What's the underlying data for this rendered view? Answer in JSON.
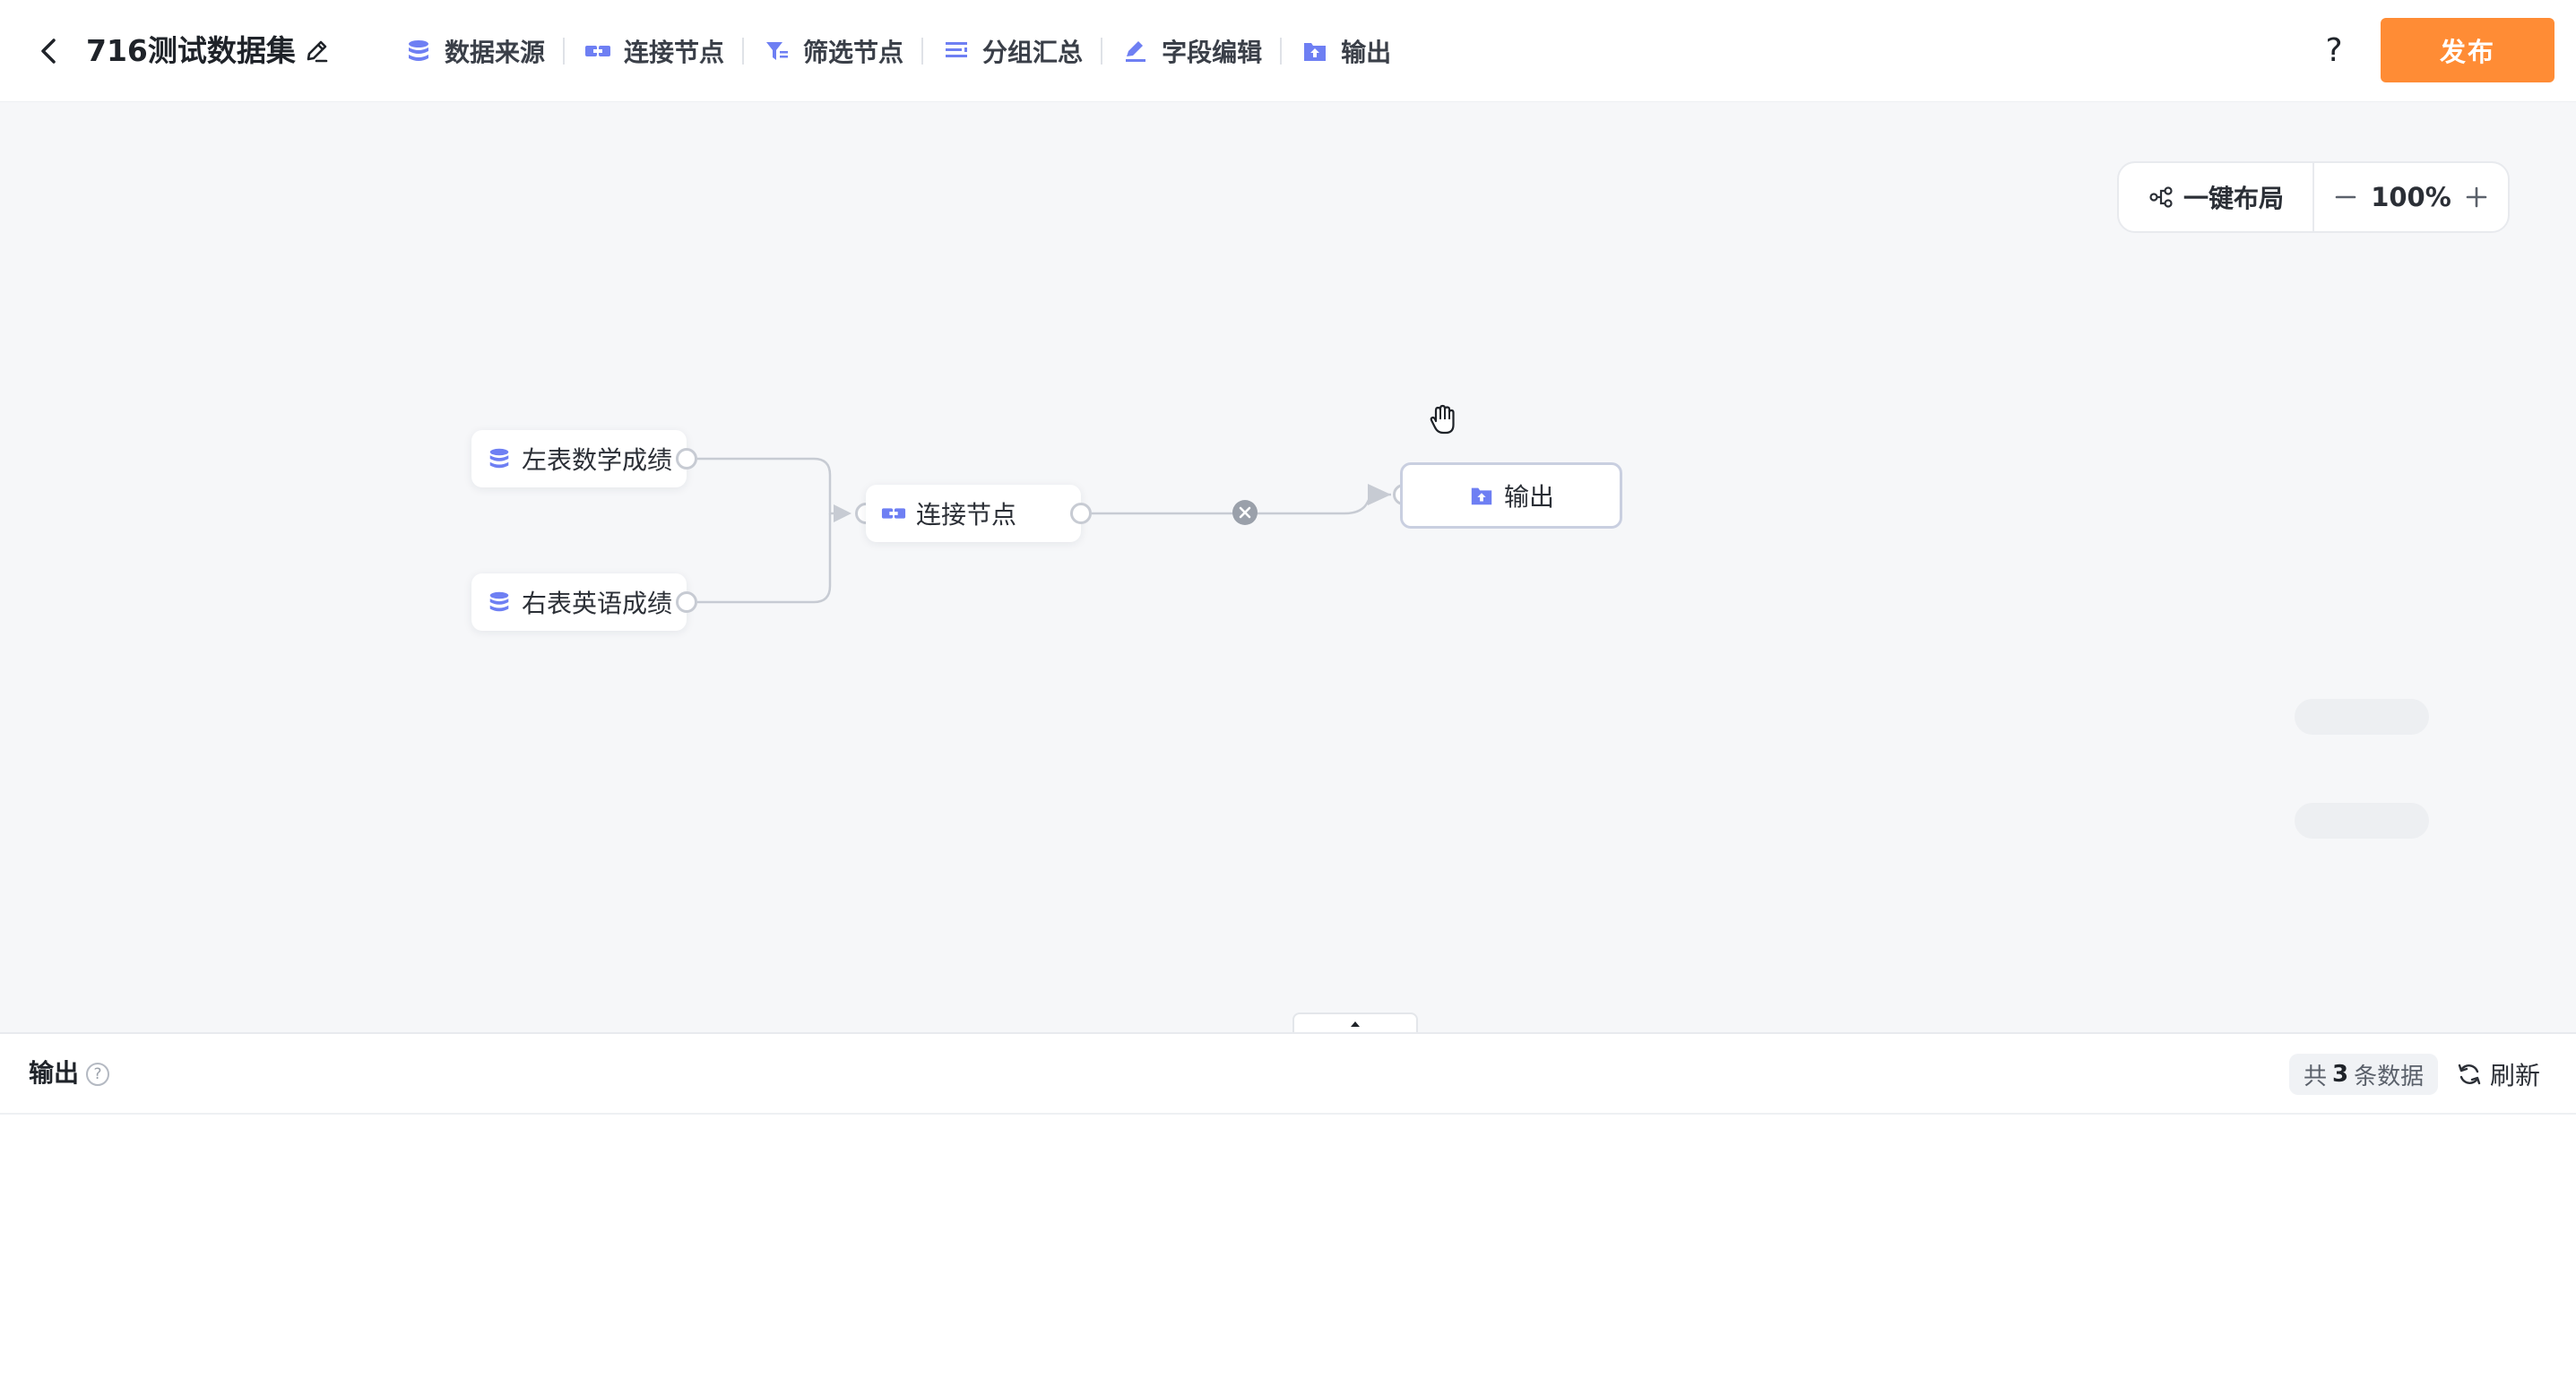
{
  "header": {
    "title": "716测试数据集",
    "toolbar": [
      {
        "label": "数据来源",
        "icon": "database-icon"
      },
      {
        "label": "连接节点",
        "icon": "join-icon"
      },
      {
        "label": "筛选节点",
        "icon": "filter-icon"
      },
      {
        "label": "分组汇总",
        "icon": "group-summary-icon"
      },
      {
        "label": "字段编辑",
        "icon": "field-edit-icon"
      },
      {
        "label": "输出",
        "icon": "output-icon"
      }
    ],
    "help_label": "?",
    "publish_label": "发布"
  },
  "canvas": {
    "auto_layout_label": "一键布局",
    "zoom": "100%",
    "nodes": {
      "left_table": "左表数学成绩",
      "right_table": "右表英语成绩",
      "join": "连接节点",
      "output": "输出"
    }
  },
  "panel": {
    "title": "输出",
    "count_prefix": "共",
    "count_value": "3",
    "count_suffix": "条数据",
    "refresh_label": "刷新"
  },
  "colors": {
    "accent": "#ff8c35",
    "node_icon": "#6e7ff3",
    "edge": "#c7cbd3"
  }
}
